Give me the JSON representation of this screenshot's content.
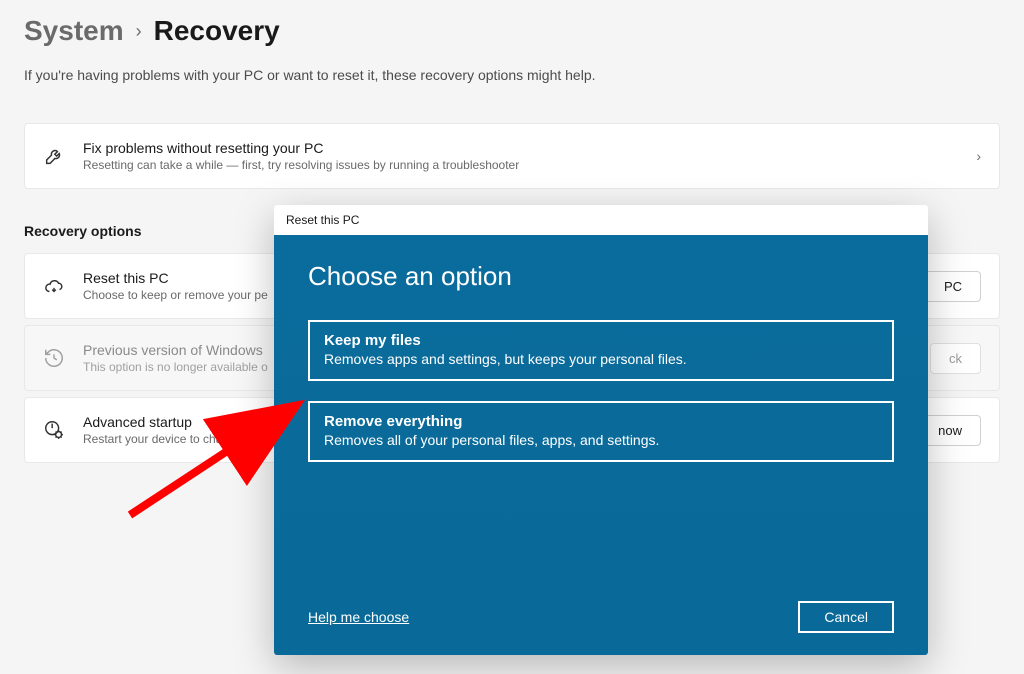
{
  "breadcrumb": {
    "root": "System",
    "sep": "›",
    "current": "Recovery"
  },
  "intro": "If you're having problems with your PC or want to reset it, these recovery options might help.",
  "fix": {
    "title": "Fix problems without resetting your PC",
    "desc": "Resetting can take a while — first, try resolving issues by running a troubleshooter"
  },
  "section": "Recovery options",
  "reset": {
    "title": "Reset this PC",
    "desc": "Choose to keep or remove your pe",
    "button": "PC"
  },
  "prev": {
    "title": "Previous version of Windows",
    "desc": "This option is no longer available o",
    "button": "ck"
  },
  "advanced": {
    "title": "Advanced startup",
    "desc": "Restart your device to chang",
    "button": "now"
  },
  "modal": {
    "header": "Reset this PC",
    "title": "Choose an option",
    "options": [
      {
        "title": "Keep my files",
        "desc": "Removes apps and settings, but keeps your personal files."
      },
      {
        "title": "Remove everything",
        "desc": "Removes all of your personal files, apps, and settings."
      }
    ],
    "help": "Help me choose",
    "cancel": "Cancel"
  }
}
